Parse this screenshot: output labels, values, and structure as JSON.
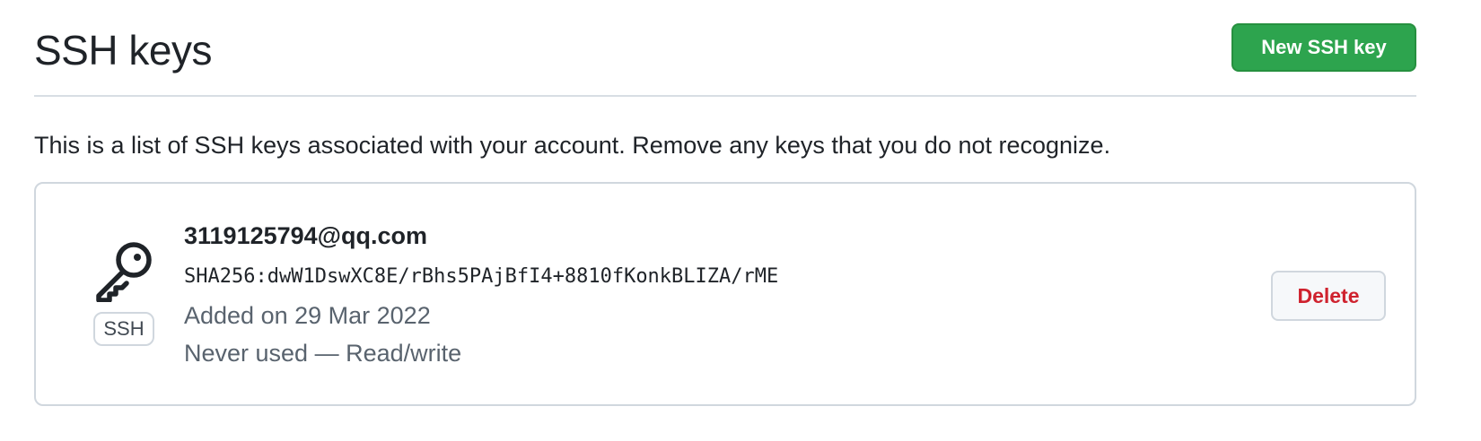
{
  "header": {
    "title": "SSH keys",
    "new_key_label": "New SSH key"
  },
  "description": "This is a list of SSH keys associated with your account. Remove any keys that you do not recognize.",
  "keys": [
    {
      "title": "3119125794@qq.com",
      "fingerprint": "SHA256:dwW1DswXC8E/rBhs5PAjBfI4+8810fKonkBLIZA/rME",
      "added": "Added on 29 Mar 2022",
      "usage": "Never used — Read/write",
      "type": "SSH",
      "icon": "key-icon",
      "delete_label": "Delete"
    }
  ],
  "colors": {
    "primary_button": "#2da44e",
    "danger_text": "#cf222e",
    "muted_text": "#59636e",
    "border": "#d0d7de"
  }
}
